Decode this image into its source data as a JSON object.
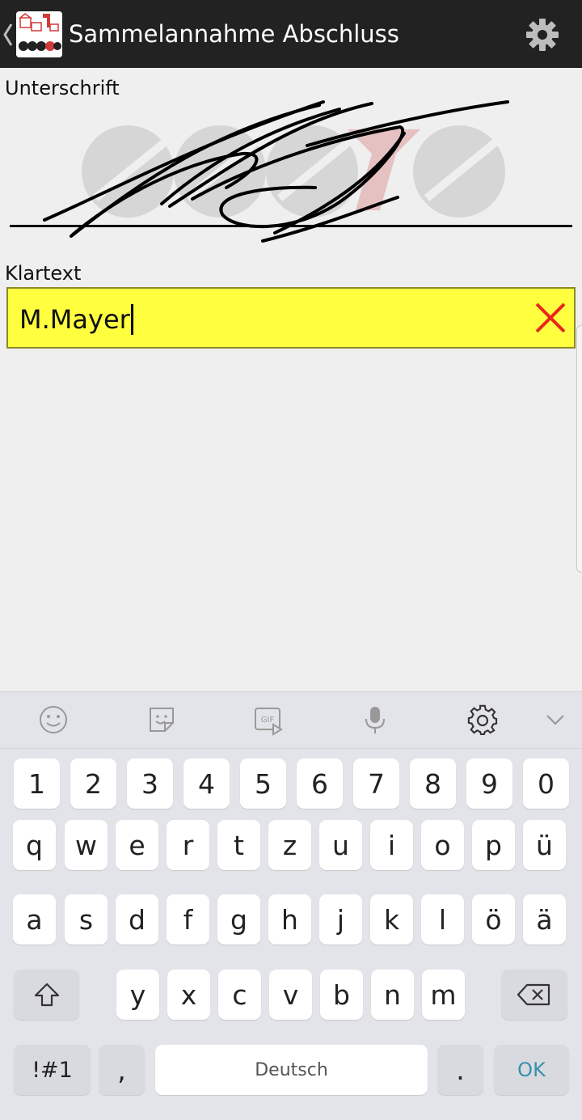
{
  "app_bar": {
    "title": "Sammelannahme Abschluss",
    "logo_icon": "app-logo-icon",
    "back_icon": "chevron-left-icon",
    "settings_icon": "gear-icon"
  },
  "signature": {
    "label": "Unterschrift",
    "watermark_logo": "coroys-logo-watermark"
  },
  "klartext": {
    "label": "Klartext",
    "value": "M.Mayer",
    "clear_icon": "close-icon",
    "field_color": "#ffff40",
    "clear_color": "#e8261c"
  },
  "keyboard": {
    "toolbar": [
      "emoji-icon",
      "sticker-icon",
      "gif-icon",
      "microphone-icon",
      "gear-icon",
      "chevron-down-icon"
    ],
    "rows": {
      "numbers": [
        "1",
        "2",
        "3",
        "4",
        "5",
        "6",
        "7",
        "8",
        "9",
        "0"
      ],
      "row1": [
        "q",
        "w",
        "e",
        "r",
        "t",
        "z",
        "u",
        "i",
        "o",
        "p",
        "ü"
      ],
      "row2": [
        "a",
        "s",
        "d",
        "f",
        "g",
        "h",
        "j",
        "k",
        "l",
        "ö",
        "ä"
      ],
      "row3": [
        "y",
        "x",
        "c",
        "v",
        "b",
        "n",
        "m"
      ]
    },
    "shift_icon": "shift-arrow-icon",
    "backspace_icon": "backspace-icon",
    "symbols_label": "!#1",
    "comma_label": ",",
    "space_label": "Deutsch",
    "period_label": ".",
    "ok_label": "OK",
    "ok_color": "#3a8fb0"
  }
}
